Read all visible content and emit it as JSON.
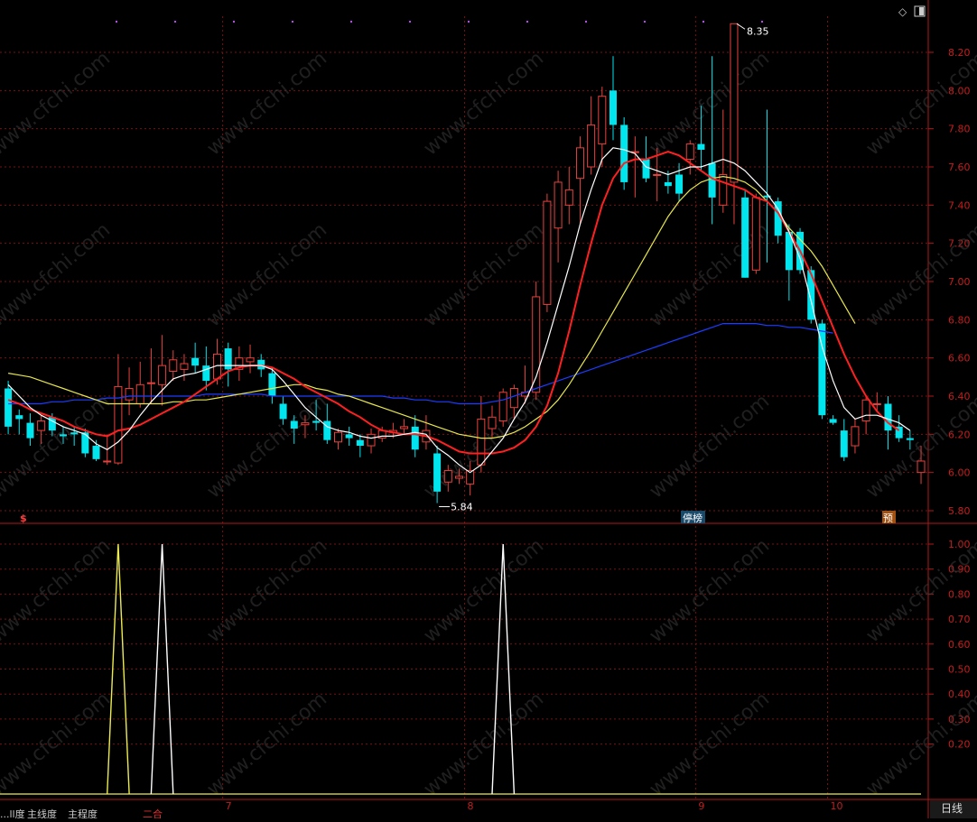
{
  "colors": {
    "background": "#000000",
    "grid": "#7a1010",
    "axis": "#b01818",
    "axis_label": "#c41e1e",
    "up_candle": "#e8413c",
    "down_candle": "#00e5ee",
    "ma5": "#ffffff",
    "ma10": "#ff2020",
    "ma20": "#e6e64c",
    "ma60": "#1c3cff",
    "signal_yellow": "#ecec50",
    "signal_white": "#ffffff",
    "watermark": "#3a3a3a"
  },
  "watermark_text": "www.cfchi.com",
  "toolbar": {
    "diamond_icon": "◇",
    "window_icon": "▯"
  },
  "markers": {
    "high_label": "8.35",
    "low_label": "5.84",
    "limit_up_badge": "停榜",
    "forecast_badge": "预",
    "dollar_marker": "$"
  },
  "bottom_bar": {
    "period_label": "日线",
    "tabs": [
      "...ll度",
      "主线度",
      "主程度",
      "二合"
    ]
  },
  "chart_data": [
    {
      "type": "candlestick",
      "title": "",
      "ylim": [
        5.75,
        8.45
      ],
      "y_ticks": [
        "8.20",
        "8.00",
        "7.80",
        "7.60",
        "7.40",
        "7.20",
        "7.00",
        "6.80",
        "6.60",
        "6.40",
        "6.20",
        "6.00",
        "5.80"
      ],
      "x_month_labels": [
        {
          "label": "7",
          "index": 20
        },
        {
          "label": "8",
          "index": 42
        },
        {
          "label": "9",
          "index": 63
        },
        {
          "label": "10",
          "index": 75
        }
      ],
      "candles": [
        {
          "o": 6.44,
          "h": 6.48,
          "l": 6.2,
          "c": 6.24
        },
        {
          "o": 6.3,
          "h": 6.33,
          "l": 6.2,
          "c": 6.28
        },
        {
          "o": 6.26,
          "h": 6.31,
          "l": 6.14,
          "c": 6.18
        },
        {
          "o": 6.22,
          "h": 6.3,
          "l": 6.15,
          "c": 6.27
        },
        {
          "o": 6.29,
          "h": 6.31,
          "l": 6.19,
          "c": 6.22
        },
        {
          "o": 6.2,
          "h": 6.24,
          "l": 6.15,
          "c": 6.19
        },
        {
          "o": 6.21,
          "h": 6.24,
          "l": 6.14,
          "c": 6.2
        },
        {
          "o": 6.21,
          "h": 6.23,
          "l": 6.08,
          "c": 6.1
        },
        {
          "o": 6.14,
          "h": 6.17,
          "l": 6.06,
          "c": 6.07
        },
        {
          "o": 6.06,
          "h": 6.2,
          "l": 6.04,
          "c": 6.06
        },
        {
          "o": 6.05,
          "h": 6.62,
          "l": 6.04,
          "c": 6.45
        },
        {
          "o": 6.38,
          "h": 6.55,
          "l": 6.3,
          "c": 6.44
        },
        {
          "o": 6.36,
          "h": 6.58,
          "l": 6.34,
          "c": 6.46
        },
        {
          "o": 6.47,
          "h": 6.65,
          "l": 6.36,
          "c": 6.47
        },
        {
          "o": 6.46,
          "h": 6.72,
          "l": 6.35,
          "c": 6.56
        },
        {
          "o": 6.53,
          "h": 6.64,
          "l": 6.48,
          "c": 6.59
        },
        {
          "o": 6.54,
          "h": 6.62,
          "l": 6.48,
          "c": 6.57
        },
        {
          "o": 6.6,
          "h": 6.68,
          "l": 6.52,
          "c": 6.56
        },
        {
          "o": 6.56,
          "h": 6.66,
          "l": 6.43,
          "c": 6.48
        },
        {
          "o": 6.49,
          "h": 6.7,
          "l": 6.46,
          "c": 6.62
        },
        {
          "o": 6.65,
          "h": 6.68,
          "l": 6.45,
          "c": 6.54
        },
        {
          "o": 6.54,
          "h": 6.66,
          "l": 6.48,
          "c": 6.6
        },
        {
          "o": 6.58,
          "h": 6.67,
          "l": 6.52,
          "c": 6.6
        },
        {
          "o": 6.59,
          "h": 6.62,
          "l": 6.5,
          "c": 6.54
        },
        {
          "o": 6.52,
          "h": 6.55,
          "l": 6.36,
          "c": 6.4
        },
        {
          "o": 6.36,
          "h": 6.4,
          "l": 6.25,
          "c": 6.28
        },
        {
          "o": 6.27,
          "h": 6.3,
          "l": 6.15,
          "c": 6.23
        },
        {
          "o": 6.25,
          "h": 6.3,
          "l": 6.18,
          "c": 6.26
        },
        {
          "o": 6.27,
          "h": 6.38,
          "l": 6.22,
          "c": 6.26
        },
        {
          "o": 6.27,
          "h": 6.36,
          "l": 6.15,
          "c": 6.17
        },
        {
          "o": 6.16,
          "h": 6.23,
          "l": 6.12,
          "c": 6.21
        },
        {
          "o": 6.2,
          "h": 6.24,
          "l": 6.14,
          "c": 6.18
        },
        {
          "o": 6.17,
          "h": 6.2,
          "l": 6.08,
          "c": 6.14
        },
        {
          "o": 6.14,
          "h": 6.23,
          "l": 6.1,
          "c": 6.2
        },
        {
          "o": 6.18,
          "h": 6.24,
          "l": 6.16,
          "c": 6.22
        },
        {
          "o": 6.21,
          "h": 6.26,
          "l": 6.18,
          "c": 6.22
        },
        {
          "o": 6.23,
          "h": 6.28,
          "l": 6.2,
          "c": 6.24
        },
        {
          "o": 6.24,
          "h": 6.3,
          "l": 6.08,
          "c": 6.12
        },
        {
          "o": 6.16,
          "h": 6.3,
          "l": 6.12,
          "c": 6.22
        },
        {
          "o": 6.1,
          "h": 6.14,
          "l": 5.84,
          "c": 5.9
        },
        {
          "o": 5.95,
          "h": 6.04,
          "l": 5.9,
          "c": 6.01
        },
        {
          "o": 5.97,
          "h": 6.02,
          "l": 5.94,
          "c": 5.98
        },
        {
          "o": 5.94,
          "h": 6.06,
          "l": 5.88,
          "c": 6.01
        },
        {
          "o": 6.04,
          "h": 6.4,
          "l": 6.0,
          "c": 6.28
        },
        {
          "o": 6.23,
          "h": 6.35,
          "l": 6.18,
          "c": 6.29
        },
        {
          "o": 6.27,
          "h": 6.44,
          "l": 6.24,
          "c": 6.42
        },
        {
          "o": 6.34,
          "h": 6.46,
          "l": 6.28,
          "c": 6.44
        },
        {
          "o": 6.4,
          "h": 6.56,
          "l": 6.36,
          "c": 6.42
        },
        {
          "o": 6.42,
          "h": 7.0,
          "l": 6.38,
          "c": 6.92
        },
        {
          "o": 6.88,
          "h": 7.46,
          "l": 6.84,
          "c": 7.42
        },
        {
          "o": 7.28,
          "h": 7.58,
          "l": 7.1,
          "c": 7.52
        },
        {
          "o": 7.4,
          "h": 7.6,
          "l": 7.3,
          "c": 7.48
        },
        {
          "o": 7.54,
          "h": 7.76,
          "l": 7.3,
          "c": 7.7
        },
        {
          "o": 7.6,
          "h": 7.97,
          "l": 7.56,
          "c": 7.82
        },
        {
          "o": 7.72,
          "h": 8.02,
          "l": 7.6,
          "c": 7.97
        },
        {
          "o": 8.0,
          "h": 8.18,
          "l": 7.74,
          "c": 7.82
        },
        {
          "o": 7.82,
          "h": 7.86,
          "l": 7.48,
          "c": 7.52
        },
        {
          "o": 7.68,
          "h": 7.76,
          "l": 7.44,
          "c": 7.68
        },
        {
          "o": 7.64,
          "h": 7.76,
          "l": 7.52,
          "c": 7.54
        },
        {
          "o": 7.56,
          "h": 7.7,
          "l": 7.42,
          "c": 7.56
        },
        {
          "o": 7.52,
          "h": 7.58,
          "l": 7.46,
          "c": 7.5
        },
        {
          "o": 7.56,
          "h": 7.62,
          "l": 7.42,
          "c": 7.46
        },
        {
          "o": 7.64,
          "h": 7.74,
          "l": 7.56,
          "c": 7.72
        },
        {
          "o": 7.72,
          "h": 7.92,
          "l": 7.58,
          "c": 7.69
        },
        {
          "o": 7.62,
          "h": 8.18,
          "l": 7.3,
          "c": 7.44
        },
        {
          "o": 7.4,
          "h": 7.9,
          "l": 7.36,
          "c": 7.56
        },
        {
          "o": 7.52,
          "h": 8.35,
          "l": 7.3,
          "c": 8.35
        },
        {
          "o": 7.44,
          "h": 7.48,
          "l": 7.02,
          "c": 7.02
        },
        {
          "o": 7.06,
          "h": 7.46,
          "l": 7.04,
          "c": 7.44
        },
        {
          "o": 7.45,
          "h": 7.9,
          "l": 7.1,
          "c": 7.44
        },
        {
          "o": 7.42,
          "h": 7.44,
          "l": 7.2,
          "c": 7.24
        },
        {
          "o": 7.26,
          "h": 7.3,
          "l": 6.9,
          "c": 7.06
        },
        {
          "o": 7.26,
          "h": 7.28,
          "l": 7.04,
          "c": 7.06
        },
        {
          "o": 7.06,
          "h": 7.08,
          "l": 6.78,
          "c": 6.8
        },
        {
          "o": 6.78,
          "h": 6.8,
          "l": 6.28,
          "c": 6.3
        },
        {
          "o": 6.28,
          "h": 6.3,
          "l": 6.25,
          "c": 6.26
        },
        {
          "o": 6.22,
          "h": 6.28,
          "l": 6.06,
          "c": 6.08
        },
        {
          "o": 6.14,
          "h": 6.28,
          "l": 6.1,
          "c": 6.24
        },
        {
          "o": 6.27,
          "h": 6.4,
          "l": 6.2,
          "c": 6.38
        },
        {
          "o": 6.36,
          "h": 6.42,
          "l": 6.32,
          "c": 6.36
        },
        {
          "o": 6.36,
          "h": 6.4,
          "l": 6.12,
          "c": 6.22
        },
        {
          "o": 6.24,
          "h": 6.3,
          "l": 6.16,
          "c": 6.18
        },
        {
          "o": 6.18,
          "h": 6.22,
          "l": 6.12,
          "c": 6.17
        },
        {
          "o": 6.0,
          "h": 6.14,
          "l": 5.94,
          "c": 6.06
        }
      ],
      "ma5": [
        6.46,
        6.4,
        6.34,
        6.3,
        6.27,
        6.24,
        6.22,
        6.2,
        6.15,
        6.12,
        6.16,
        6.22,
        6.3,
        6.37,
        6.43,
        6.49,
        6.51,
        6.52,
        6.54,
        6.56,
        6.56,
        6.56,
        6.56,
        6.56,
        6.54,
        6.48,
        6.41,
        6.34,
        6.29,
        6.24,
        6.22,
        6.21,
        6.19,
        6.18,
        6.19,
        6.19,
        6.2,
        6.21,
        6.2,
        6.13,
        6.09,
        6.04,
        6.0,
        6.04,
        6.11,
        6.18,
        6.28,
        6.37,
        6.5,
        6.68,
        6.88,
        7.08,
        7.3,
        7.48,
        7.64,
        7.7,
        7.69,
        7.67,
        7.6,
        7.58,
        7.56,
        7.58,
        7.6,
        7.6,
        7.62,
        7.64,
        7.62,
        7.58,
        7.52,
        7.46,
        7.38,
        7.26,
        7.12,
        6.9,
        6.66,
        6.48,
        6.34,
        6.28,
        6.3,
        6.3,
        6.28,
        6.26,
        6.22
      ],
      "ma10": [
        6.38,
        6.36,
        6.33,
        6.31,
        6.29,
        6.27,
        6.24,
        6.22,
        6.2,
        6.19,
        6.22,
        6.23,
        6.25,
        6.28,
        6.31,
        6.34,
        6.37,
        6.41,
        6.45,
        6.49,
        6.53,
        6.55,
        6.56,
        6.56,
        6.55,
        6.52,
        6.49,
        6.45,
        6.42,
        6.39,
        6.36,
        6.32,
        6.29,
        6.25,
        6.22,
        6.21,
        6.2,
        6.2,
        6.19,
        6.17,
        6.14,
        6.11,
        6.1,
        6.1,
        6.1,
        6.11,
        6.13,
        6.17,
        6.24,
        6.35,
        6.52,
        6.74,
        6.98,
        7.2,
        7.4,
        7.54,
        7.62,
        7.64,
        7.64,
        7.66,
        7.68,
        7.66,
        7.62,
        7.58,
        7.54,
        7.52,
        7.5,
        7.48,
        7.44,
        7.42,
        7.36,
        7.26,
        7.16,
        7.04,
        6.9,
        6.76,
        6.62,
        6.5,
        6.4,
        6.32,
        6.26,
        6.22
      ],
      "ma20": [
        6.52,
        6.51,
        6.5,
        6.48,
        6.46,
        6.44,
        6.42,
        6.4,
        6.38,
        6.36,
        6.36,
        6.36,
        6.36,
        6.36,
        6.36,
        6.37,
        6.37,
        6.38,
        6.38,
        6.39,
        6.4,
        6.41,
        6.42,
        6.43,
        6.44,
        6.45,
        6.46,
        6.46,
        6.44,
        6.43,
        6.41,
        6.4,
        6.38,
        6.36,
        6.34,
        6.32,
        6.3,
        6.28,
        6.26,
        6.24,
        6.22,
        6.2,
        6.19,
        6.18,
        6.18,
        6.19,
        6.21,
        6.24,
        6.28,
        6.32,
        6.38,
        6.46,
        6.55,
        6.64,
        6.74,
        6.84,
        6.94,
        7.04,
        7.14,
        7.24,
        7.34,
        7.42,
        7.48,
        7.52,
        7.54,
        7.55,
        7.54,
        7.52,
        7.48,
        7.42,
        7.36,
        7.28,
        7.22,
        7.16,
        7.08,
        6.98,
        6.88,
        6.78
      ],
      "ma60": [
        6.36,
        6.36,
        6.36,
        6.36,
        6.37,
        6.37,
        6.38,
        6.38,
        6.38,
        6.39,
        6.39,
        6.4,
        6.4,
        6.4,
        6.4,
        6.4,
        6.4,
        6.4,
        6.41,
        6.41,
        6.41,
        6.41,
        6.41,
        6.41,
        6.4,
        6.4,
        6.4,
        6.4,
        6.4,
        6.4,
        6.4,
        6.4,
        6.4,
        6.4,
        6.4,
        6.39,
        6.39,
        6.38,
        6.38,
        6.37,
        6.37,
        6.36,
        6.36,
        6.36,
        6.37,
        6.38,
        6.4,
        6.42,
        6.44,
        6.46,
        6.48,
        6.5,
        6.52,
        6.54,
        6.56,
        6.58,
        6.6,
        6.62,
        6.64,
        6.66,
        6.68,
        6.7,
        6.72,
        6.74,
        6.76,
        6.78,
        6.78,
        6.78,
        6.78,
        6.77,
        6.77,
        6.76,
        6.76,
        6.75,
        6.74,
        6.73
      ]
    },
    {
      "type": "line",
      "title": "",
      "ylim": [
        0,
        1.05
      ],
      "y_ticks": [
        "1.00",
        "0.90",
        "0.80",
        "0.70",
        "0.60",
        "0.50",
        "0.40",
        "0.30",
        "0.20"
      ],
      "series": [
        {
          "color": "yellow",
          "x": [
            9,
            10,
            11
          ],
          "values": [
            0,
            1,
            0
          ]
        },
        {
          "color": "white",
          "x": [
            13,
            14,
            15
          ],
          "values": [
            0,
            1,
            0
          ]
        },
        {
          "color": "white",
          "x": [
            44,
            45,
            46
          ],
          "values": [
            0,
            1,
            0
          ]
        }
      ],
      "baseline": 0
    }
  ]
}
